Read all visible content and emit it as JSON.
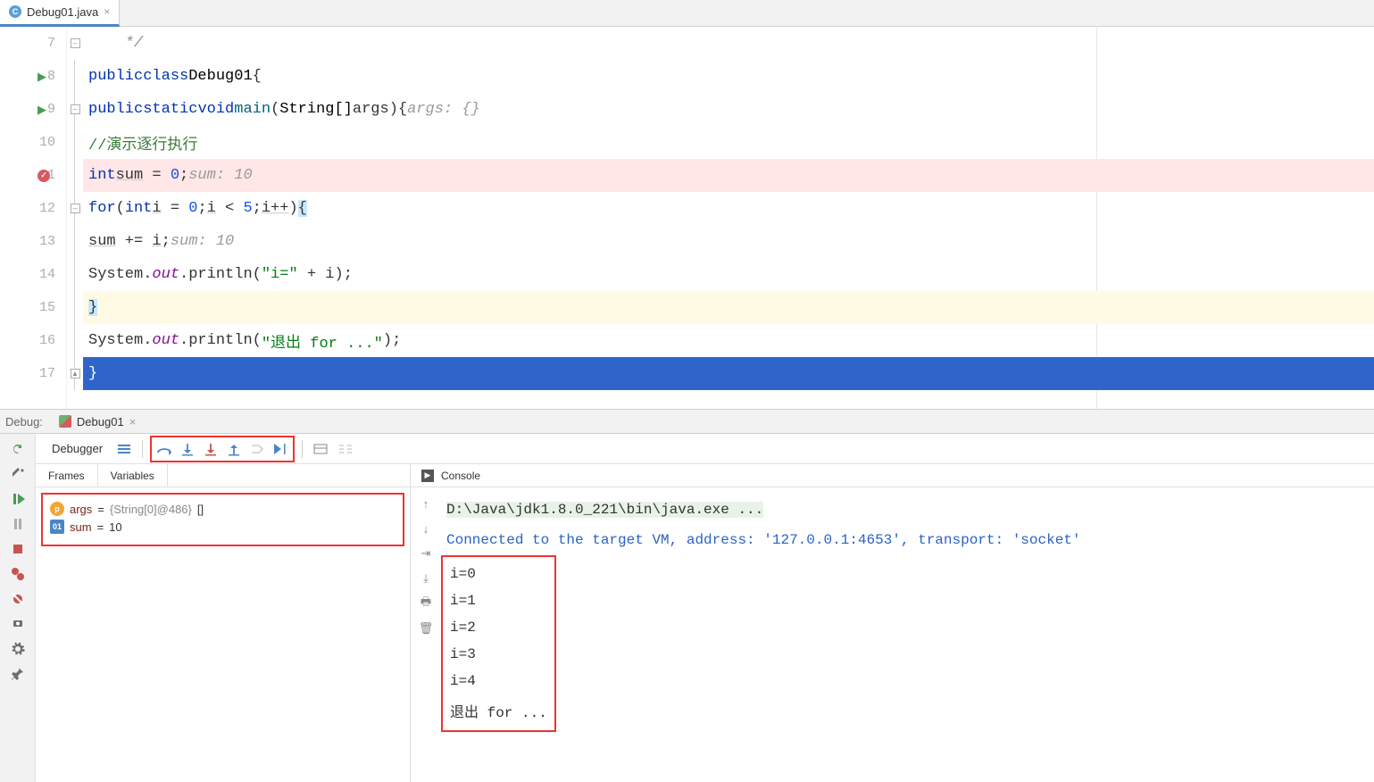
{
  "tab": {
    "filename": "Debug01.java"
  },
  "editor": {
    "lines": {
      "l7": {
        "num": "7",
        "text": "    */"
      },
      "l8": {
        "num": "8"
      },
      "l9": {
        "num": "9"
      },
      "l10": {
        "num": "10",
        "comment": "//演示逐行执行"
      },
      "l11": {
        "num": "11",
        "hint": "sum: 10"
      },
      "l12": {
        "num": "12"
      },
      "l13": {
        "num": "13",
        "hint": "sum: 10"
      },
      "l14": {
        "num": "14"
      },
      "l15": {
        "num": "15"
      },
      "l16": {
        "num": "16"
      },
      "l17": {
        "num": "17"
      }
    },
    "tokens": {
      "public": "public",
      "class": "class",
      "static": "static",
      "void": "void",
      "className": "Debug01",
      "main": "main",
      "stringArr": "String[]",
      "args": "args",
      "argsHint": "args: {}",
      "int": "int",
      "sum": "sum",
      "zero": "0",
      "for": "for",
      "i": "i",
      "five": "5",
      "incr": "i++",
      "sumPlus": "sum",
      "plusEq": " += ",
      "semi": ";",
      "system": "System",
      "out": "out",
      "println": "println",
      "strIEq": "\"i=\"",
      "plus": " + ",
      "iVar": "i",
      "strExit": "\"退出 for ...\"",
      "lt": " < ",
      "eq": " = ",
      "lparen": "(",
      "rparen": ")",
      "lbrace": "{",
      "rbrace": "}",
      "dot": "."
    }
  },
  "debug": {
    "title": "Debug:",
    "config": "Debug01",
    "debuggerTab": "Debugger",
    "framesTab": "Frames",
    "variablesTab": "Variables",
    "consoleTab": "Console",
    "vars": [
      {
        "badge": "p",
        "name": "args",
        "eq": " = ",
        "type": "{String[0]@486}",
        "val": " []"
      },
      {
        "badge": "01",
        "name": "sum",
        "eq": " = ",
        "val": "10"
      }
    ],
    "console": {
      "cmd": "D:\\Java\\jdk1.8.0_221\\bin\\java.exe ...",
      "connected": "Connected to the target VM, address: '127.0.0.1:4653', transport: 'socket'",
      "output": [
        "i=0",
        "i=1",
        "i=2",
        "i=3",
        "i=4",
        "退出 for ..."
      ]
    }
  }
}
